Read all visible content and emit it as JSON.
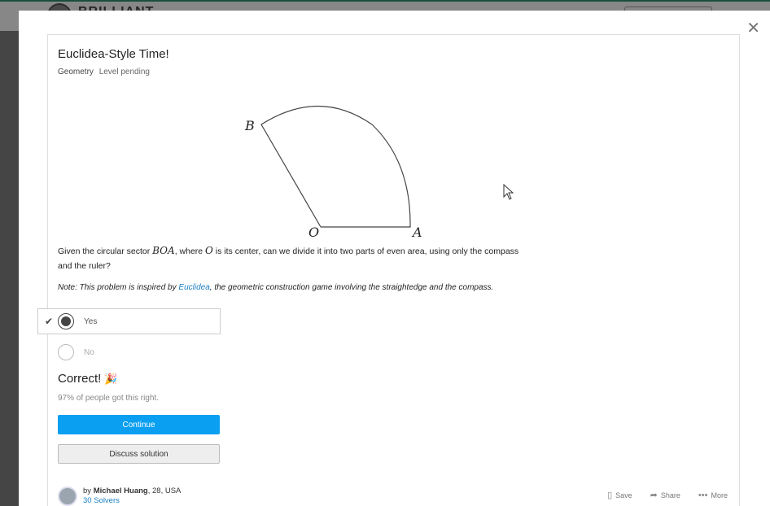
{
  "background": {
    "brand_text": "BRILLIANT"
  },
  "modal": {
    "close_icon": "close-icon",
    "title": "Euclidea-Style Time!",
    "topic": "Geometry",
    "level": "Level pending",
    "diagram": {
      "label_b": "B",
      "label_o": "O",
      "label_a": "A"
    },
    "question": {
      "p1": "Given the circular sector ",
      "sector": "BOA",
      "p2": ", where ",
      "center": "O",
      "p3": " is its center, can we divide it into two parts of even area, using only the compass and the ruler?"
    },
    "note": {
      "prefix": "Note: This problem is inspired by ",
      "link": "Euclidea",
      "suffix": ", the geometric construction game involving the straightedge and the compass."
    },
    "options": [
      {
        "label": "Yes",
        "selected": true,
        "correct": true
      },
      {
        "label": "No",
        "selected": false
      }
    ],
    "result": {
      "heading": "Correct!",
      "emoji": "🎉",
      "percent_text": "97% of people got this right."
    },
    "buttons": {
      "continue": "Continue",
      "discuss": "Discuss solution"
    },
    "author": {
      "by": "by",
      "name": "Michael Huang",
      "details": ", 28, USA",
      "solvers": "30 Solvers"
    },
    "actions": {
      "save": "Save",
      "share": "Share",
      "more": "More"
    }
  },
  "colors": {
    "accent": "#0a9ff0",
    "link": "#1a7fc1",
    "brand_green": "#2f8f6f"
  }
}
